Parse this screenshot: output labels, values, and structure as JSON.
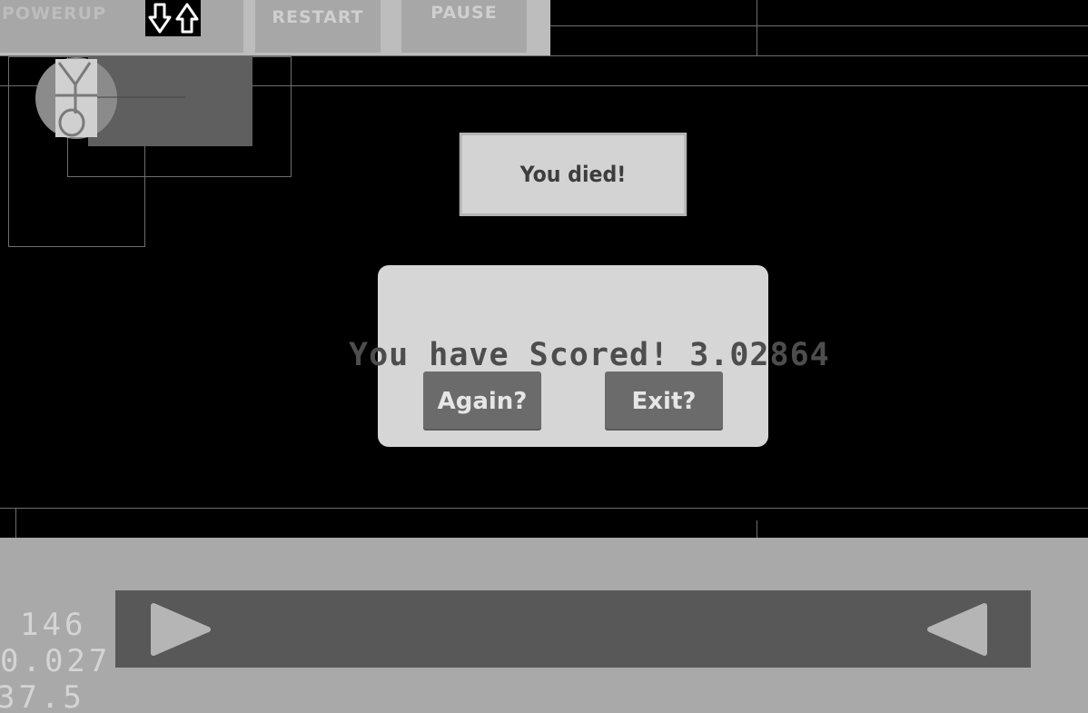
{
  "toolbar": {
    "powerup_label": "POWERUP",
    "restart_label": "RESTART",
    "pause_label": "PAUSE",
    "gravity_icon": "down-up-arrows-icon"
  },
  "game_over": {
    "title": "You died!",
    "score_text": "You have Scored! 3.02864",
    "again_label": "Again?",
    "exit_label": "Exit?"
  },
  "controls": {
    "right_arrow_icon": "play-right-icon",
    "left_arrow_icon": "play-left-icon"
  },
  "stats": {
    "line1": "146",
    "line2": "0.027",
    "line3": "37.5"
  },
  "colors": {
    "background": "#000000",
    "panel": "#d6d6d6",
    "button": "#6b6b6b",
    "bottom_bar": "#a9a9a9",
    "control_strip": "#585858"
  }
}
